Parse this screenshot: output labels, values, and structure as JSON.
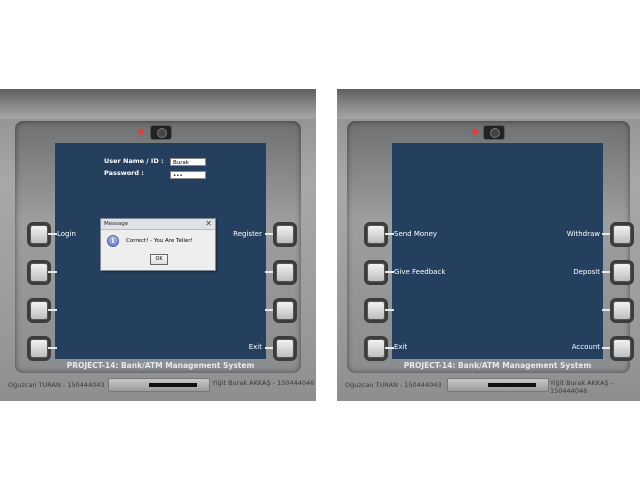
{
  "project_title": "PROJECT-14: Bank/ATM Management System",
  "credits": {
    "left": "Oğuzcan TURAN - 150444043",
    "right": "Yiğit Burak AKKAŞ - 150444046"
  },
  "login_screen": {
    "username_label": "User Name / ID :",
    "username_value": "Burak",
    "password_label": "Password :",
    "password_value": "•••",
    "left_labels": [
      "Login",
      "",
      "",
      ""
    ],
    "right_labels": [
      "Register",
      "",
      "",
      "Exit"
    ],
    "dialog": {
      "title": "Message",
      "close": "✕",
      "icon": "i",
      "message": "Correct! - You Are Teller!",
      "ok": "OK"
    }
  },
  "menu_screen": {
    "left_labels": [
      "Send Money",
      "Give Feedback",
      "",
      "Exit"
    ],
    "right_labels": [
      "Withdraw",
      "Deposit",
      "",
      "Account"
    ]
  },
  "colors": {
    "screen": "#25405f",
    "led": "#ff2a2a"
  }
}
